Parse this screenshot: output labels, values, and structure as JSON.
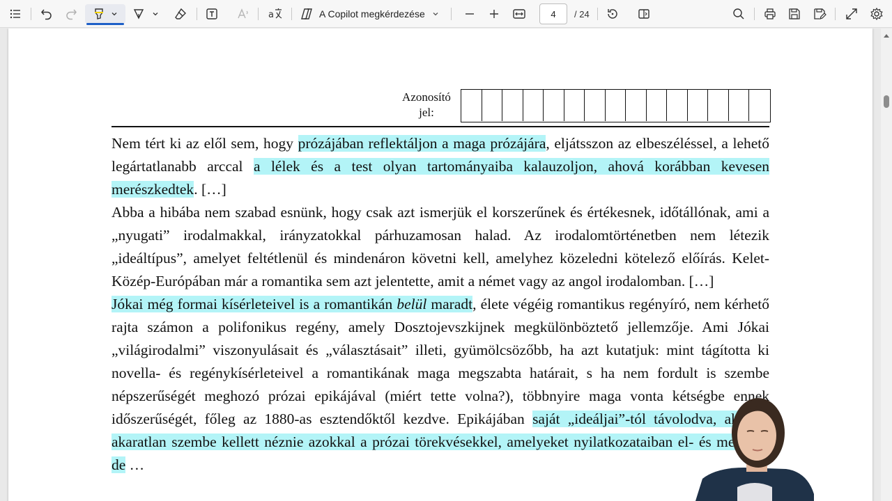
{
  "toolbar": {
    "copilot_label": "A Copilot megkérdezése",
    "current_page": "4",
    "total_pages": "/ 24"
  },
  "page": {
    "id_label_line1": "Azonosító",
    "id_label_line2": "jel:",
    "id_box_count": 15
  },
  "text": {
    "p1": {
      "a": "Nem tért ki az elől sem, hogy ",
      "b": "prózájában reflektáljon a maga prózájára",
      "c": ", eljátsszon az elbeszéléssel, a lehető legártatlanabb arccal ",
      "d": "a lélek és a test olyan tartományaiba kalauzoljon, ahová korábban kevesen merészkedtek",
      "e": ". […]"
    },
    "p2": "Abba a hibába nem szabad esnünk, hogy csak azt ismerjük el korszerűnek és értékesnek, időtállónak, ami a „nyugati” irodalmakkal, irányzatokkal párhuzamosan halad. Az irodalomtörténetben nem létezik „ideáltípus”, amelyet feltétlenül és mindenáron követni kell, amelyhez közeledni kötelező előírás. Kelet-Közép-Európában már a romantika sem azt jelentette, amit a német vagy az angol irodalomban. […]",
    "p3": {
      "a": "Jókai még formai kísérleteivel is a romantikán ",
      "b_italic": "belül",
      "c": " maradt",
      "d": ", élete végéig romantikus regényíró, nem kérhető rajta számon a polifonikus regény, amely Dosztojevszkijnek megkülönböztető jellemzője. Ami Jókai „világirodalmi” viszonyulásait és „választásait” illeti, gyümölcsözőbb, ha azt kutatjuk: mint tágította ki novella- és regénykísérleteivel a romantikának maga megszabta határait, s ha nem fordult is szembe népszerűségét meghozó prózai epikájával (miért tette volna?), többnyire maga vonta kétségbe ennek időszerűségét, főleg az 1880-as esztendőktől kezdve. Epikájában ",
      "e": "saját „ideáljai”-tól távolodva, akarva-akaratlan szembe kellett néznie azokkal a prózai törekvésekkel, amelyeket nyilatkozataiban el- és megítélt, de",
      "f": " …"
    }
  },
  "colors": {
    "highlight": "#b3f4f7",
    "accent": "#1d5fc7"
  },
  "icons": [
    "contents-list-icon",
    "undo-icon",
    "redo-icon",
    "highlight-icon",
    "chevron-down-icon",
    "draw-icon",
    "eraser-icon",
    "text-box-icon",
    "read-aloud-icon",
    "translate-icon",
    "copilot-icon",
    "zoom-out-icon",
    "zoom-in-icon",
    "fit-width-icon",
    "rotate-icon",
    "page-view-icon",
    "search-icon",
    "print-icon",
    "save-icon",
    "save-as-icon",
    "expand-icon",
    "settings-icon"
  ]
}
